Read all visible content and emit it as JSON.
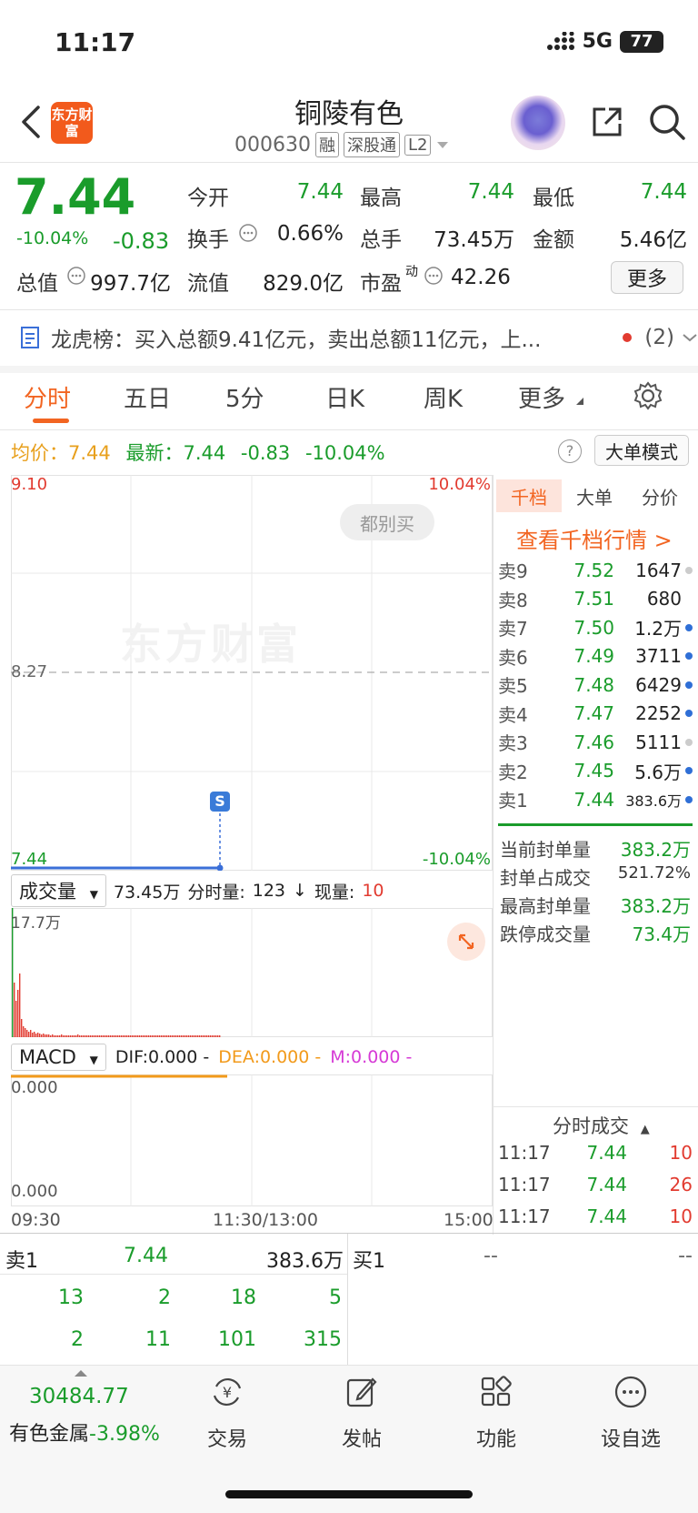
{
  "status": {
    "time": "11:17",
    "network": "5G",
    "battery": "77"
  },
  "header": {
    "logo": "东方财富",
    "title": "铜陵有色",
    "code": "000630",
    "tags": [
      "融",
      "深股通",
      "L2"
    ]
  },
  "quote": {
    "price": "7.44",
    "change_pct": "-10.04%",
    "change": "-0.83",
    "open_label": "今开",
    "open": "7.44",
    "high_label": "最高",
    "high": "7.44",
    "low_label": "最低",
    "low": "7.44",
    "turnover_label": "换手",
    "turnover": "0.66%",
    "volume_label": "总手",
    "volume": "73.45万",
    "amount_label": "金额",
    "amount": "5.46亿",
    "total_mv_label": "总值",
    "total_mv": "997.7亿",
    "float_mv_label": "流值",
    "float_mv": "829.0亿",
    "pe_label": "市盈",
    "pe_sup": "动",
    "pe": "42.26",
    "more_label": "更多"
  },
  "dragon_tiger": {
    "text": "龙虎榜：买入总额9.41亿元，卖出总额11亿元，上...",
    "count": "(2)"
  },
  "tabs": [
    "分时",
    "五日",
    "5分",
    "日K",
    "周K",
    "更多"
  ],
  "avg_line": {
    "avg_label": "均价：",
    "avg": "7.44",
    "latest_label": "最新：",
    "latest": "7.44",
    "chg": "-0.83",
    "pct": "-10.04%"
  },
  "big_order_mode": "大单模式",
  "chart": {
    "y_top": "9.10",
    "y_mid": "8.27",
    "y_bottom": "7.44",
    "pct_top": "10.04%",
    "pct_bottom": "-10.04%",
    "watermark": "东方财富",
    "bubble": "都别买",
    "marker": "S"
  },
  "volume_panel": {
    "selector": "成交量",
    "total": "73.45万",
    "fst_label": "分时量:",
    "fst": "123",
    "cur_label": "现量:",
    "cur": "10",
    "max": "17.7万"
  },
  "macd_panel": {
    "selector": "MACD",
    "dif": "DIF:0.000 -",
    "dea": "DEA:0.000 -",
    "m": "M:0.000 -",
    "y_top": "0.000",
    "y_bottom": "0.000"
  },
  "time_axis": [
    "09:30",
    "11:30/13:00",
    "15:00"
  ],
  "right_panel": {
    "tabs": [
      "千档",
      "大单",
      "分价"
    ],
    "qiandang_link": "查看千档行情 >",
    "asks": [
      {
        "label": "卖9",
        "price": "7.52",
        "vol": "1647",
        "dot": "gray"
      },
      {
        "label": "卖8",
        "price": "7.51",
        "vol": "680",
        "dot": "none"
      },
      {
        "label": "卖7",
        "price": "7.50",
        "vol": "1.2万",
        "dot": "blue"
      },
      {
        "label": "卖6",
        "price": "7.49",
        "vol": "3711",
        "dot": "blue"
      },
      {
        "label": "卖5",
        "price": "7.48",
        "vol": "6429",
        "dot": "blue"
      },
      {
        "label": "卖4",
        "price": "7.47",
        "vol": "2252",
        "dot": "blue"
      },
      {
        "label": "卖3",
        "price": "7.46",
        "vol": "5111",
        "dot": "gray"
      },
      {
        "label": "卖2",
        "price": "7.45",
        "vol": "5.6万",
        "dot": "blue"
      },
      {
        "label": "卖1",
        "price": "7.44",
        "vol": "383.6万",
        "dot": "blue"
      }
    ],
    "seal": [
      {
        "label": "当前封单量",
        "value": "383.2万"
      },
      {
        "label": "封单占成交",
        "value": "521.72%"
      },
      {
        "label": "最高封单量",
        "value": "383.2万"
      },
      {
        "label": "跌停成交量",
        "value": "73.4万"
      }
    ],
    "fst_title": "分时成交",
    "trades": [
      {
        "time": "11:17",
        "price": "7.44",
        "vol": "10"
      },
      {
        "time": "11:17",
        "price": "7.44",
        "vol": "26"
      },
      {
        "time": "11:17",
        "price": "7.44",
        "vol": "10"
      }
    ]
  },
  "book": {
    "sell1_label": "卖1",
    "sell1_price": "7.44",
    "sell1_vol": "383.6万",
    "buy1_label": "买1",
    "buy1_price": "--",
    "buy1_vol": "--",
    "row1": [
      "13",
      "2",
      "18",
      "5"
    ],
    "row2": [
      "2",
      "11",
      "101",
      "315"
    ]
  },
  "nav": {
    "index_value": "30484.77",
    "index_label": "有色金属",
    "index_pct": "-3.98%",
    "items": [
      "交易",
      "发帖",
      "功能",
      "设自选"
    ]
  }
}
